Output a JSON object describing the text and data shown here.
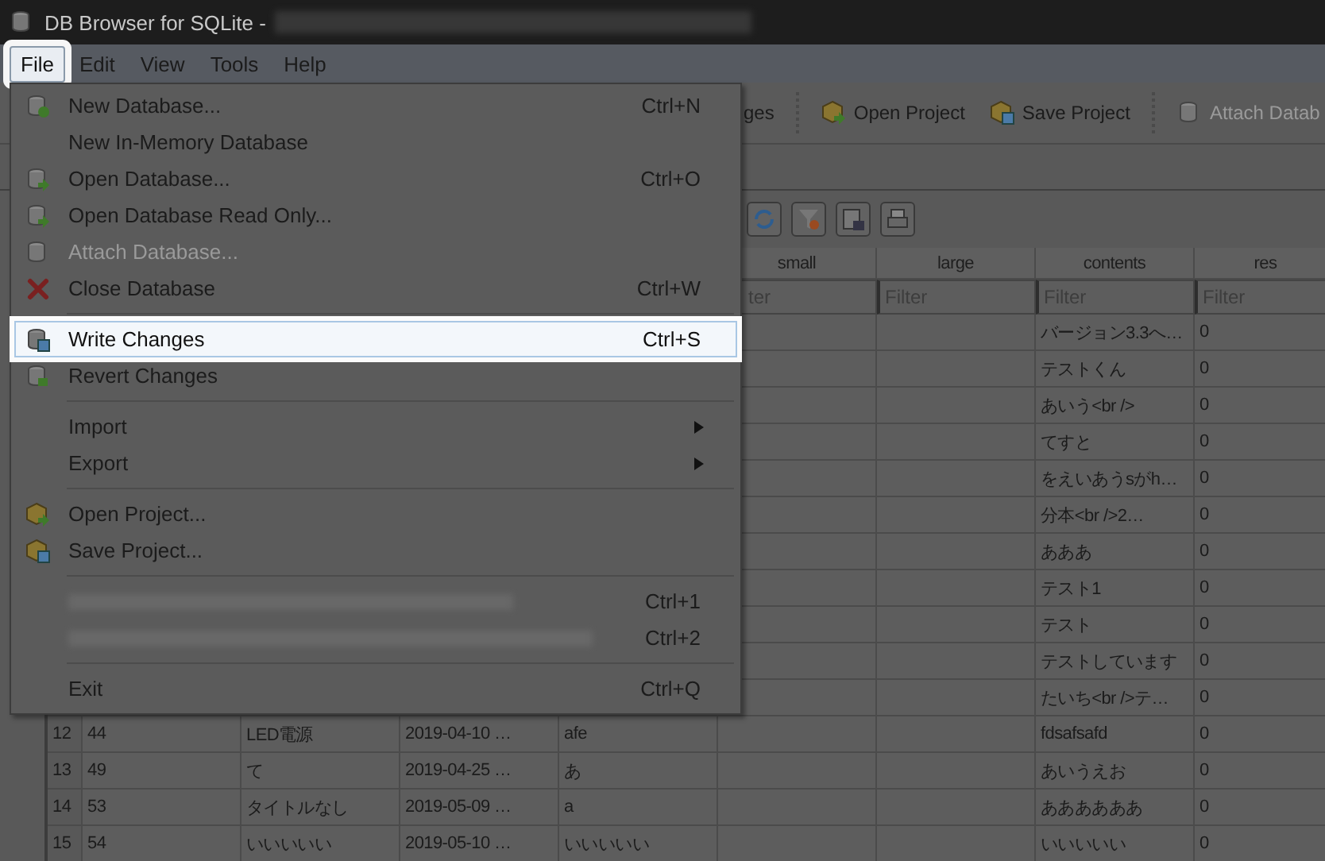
{
  "window": {
    "title": "DB Browser for SQLite -"
  },
  "menubar": [
    {
      "label": "File",
      "selected": true
    },
    {
      "label": "Edit",
      "selected": false
    },
    {
      "label": "View",
      "selected": false
    },
    {
      "label": "Tools",
      "selected": false
    },
    {
      "label": "Help",
      "selected": false
    }
  ],
  "toolbar": [
    {
      "label": "ges",
      "disabled": false
    },
    {
      "label": "Open Project",
      "disabled": false
    },
    {
      "label": "Save Project",
      "disabled": false
    },
    {
      "label": "Attach Datab",
      "disabled": true
    }
  ],
  "file_menu": [
    {
      "kind": "item",
      "label": "New Database...",
      "shortcut": "Ctrl+N",
      "selected": false,
      "disabled": false
    },
    {
      "kind": "item",
      "label": "New In-Memory Database",
      "selected": false,
      "disabled": false
    },
    {
      "kind": "item",
      "label": "Open Database...",
      "shortcut": "Ctrl+O",
      "selected": false,
      "disabled": false
    },
    {
      "kind": "item",
      "label": "Open Database Read Only...",
      "selected": false,
      "disabled": false
    },
    {
      "kind": "item",
      "label": "Attach Database...",
      "selected": false,
      "disabled": true
    },
    {
      "kind": "item",
      "label": "Close Database",
      "shortcut": "Ctrl+W",
      "selected": false,
      "disabled": false
    },
    {
      "kind": "separator"
    },
    {
      "kind": "item",
      "label": "Write Changes",
      "shortcut": "Ctrl+S",
      "selected": true,
      "disabled": false
    },
    {
      "kind": "item",
      "label": "Revert Changes",
      "selected": false,
      "disabled": false
    },
    {
      "kind": "separator"
    },
    {
      "kind": "submenu",
      "label": "Import",
      "selected": false,
      "disabled": false
    },
    {
      "kind": "submenu",
      "label": "Export",
      "selected": false,
      "disabled": false
    },
    {
      "kind": "separator"
    },
    {
      "kind": "item",
      "label": "Open Project...",
      "selected": false,
      "disabled": false
    },
    {
      "kind": "item",
      "label": "Save Project...",
      "selected": false,
      "disabled": false
    },
    {
      "kind": "separator"
    },
    {
      "kind": "recent",
      "shortcut": "Ctrl+1",
      "selected": false,
      "disabled": false
    },
    {
      "kind": "recent",
      "shortcut": "Ctrl+2",
      "selected": false,
      "disabled": false
    },
    {
      "kind": "separator"
    },
    {
      "kind": "item",
      "label": "Exit",
      "shortcut": "Ctrl+Q",
      "selected": false,
      "disabled": false
    }
  ],
  "table": {
    "columns": [
      {
        "header": "small",
        "filter_placeholder": "ter"
      },
      {
        "header": "large",
        "filter_placeholder": "Filter"
      },
      {
        "header": "contents",
        "filter_placeholder": "Filter"
      },
      {
        "header": "res",
        "filter_placeholder": "Filter"
      }
    ],
    "rows": [
      {
        "contents": "バージョン3.3へ…",
        "res": "0"
      },
      {
        "contents": "テストくん",
        "res": "0"
      },
      {
        "contents": "あいう<br />",
        "res": "0"
      },
      {
        "contents": "てすと",
        "res": "0"
      },
      {
        "contents": "をえいあうsがh…",
        "res": "0"
      },
      {
        "contents": "分本<br />2…",
        "res": "0"
      },
      {
        "contents": "あああ",
        "res": "0"
      },
      {
        "contents": "テスト1",
        "res": "0"
      },
      {
        "contents": "テスト",
        "res": "0"
      },
      {
        "contents": "テストしています",
        "res": "0"
      },
      {
        "contents": "たいち<br />テ…",
        "res": "0"
      },
      {
        "number": "12",
        "leading": [
          "44",
          "LED電源",
          "2019-04-10 …",
          "afe"
        ],
        "contents": "fdsafsafd",
        "res": "0"
      },
      {
        "number": "13",
        "leading": [
          "49",
          "て",
          "2019-04-25 …",
          "あ"
        ],
        "contents": "あいうえお",
        "res": "0"
      },
      {
        "number": "14",
        "leading": [
          "53",
          "タイトルなし",
          "2019-05-09 …",
          "a"
        ],
        "contents": "ああああああ",
        "res": "0"
      },
      {
        "number": "15",
        "leading": [
          "54",
          "いいいいい",
          "2019-05-10 …",
          "いいいいい"
        ],
        "contents": "いいいいい",
        "res": "0"
      }
    ]
  }
}
